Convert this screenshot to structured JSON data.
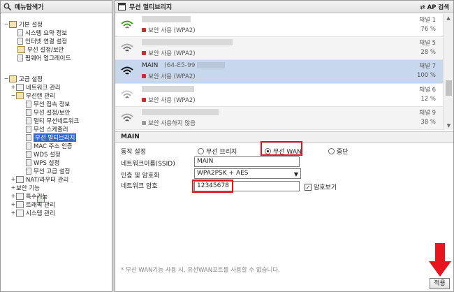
{
  "menu": {
    "title": "메뉴탐색기",
    "items": [
      {
        "label": "기본 설정"
      },
      {
        "label": "시스템 요약 정보"
      },
      {
        "label": "인터넷 연결 설정"
      },
      {
        "label": "무선 설정/보안"
      },
      {
        "label": "펌웨어 업그레이드"
      },
      {
        "label": "고급 설정"
      },
      {
        "label": "네트워크 관리"
      },
      {
        "label": "무선랜 관리"
      },
      {
        "label": "무선 접속 정보"
      },
      {
        "label": "무선 설정/보안"
      },
      {
        "label": "멀티 무선네트워크"
      },
      {
        "label": "무선 스케줄러"
      },
      {
        "label": "무선 멀티브리지"
      },
      {
        "label": "MAC 주소 인증"
      },
      {
        "label": "WDS 설정"
      },
      {
        "label": "WPS 설정"
      },
      {
        "label": "무선 고급 설정"
      },
      {
        "label": "NAT/라우터 관리"
      },
      {
        "label": "보안 기능"
      },
      {
        "label": "특수기능"
      },
      {
        "label": "트래픽 관리"
      },
      {
        "label": "시스템 관리"
      }
    ],
    "toggles": {
      "expanded": "−",
      "collapsed": "+"
    }
  },
  "main": {
    "title": "무선 멀티브리지",
    "ap_search": "AP 검색"
  },
  "ap_list": [
    {
      "ssid": "",
      "mac": "",
      "security": "보안 사용 (WPA2)",
      "channel": "채널 1",
      "signal": "76 %"
    },
    {
      "ssid": "",
      "mac": "",
      "security": "보안 사용 (WPA2)",
      "channel": "채널 5",
      "signal": "28 %"
    },
    {
      "ssid": "MAIN",
      "mac": "(64-E5-99",
      "security": "보안 사용 (WPA2)",
      "channel": "채널 7",
      "signal": "100 %"
    },
    {
      "ssid": "",
      "mac": "",
      "security": "보안 사용 (WPA2)",
      "channel": "채널 6",
      "signal": "12 %"
    },
    {
      "ssid": "",
      "mac": "",
      "security": "보안 사용하지 않음",
      "channel": "채널 9",
      "signal": "38 %"
    }
  ],
  "form": {
    "section_title": "MAIN",
    "mode_label": "동작 설정",
    "mode_options": [
      "무선 브리지",
      "무선 WAN",
      "중단"
    ],
    "ssid_label": "네트워크이름(SSID)",
    "ssid_value": "MAIN",
    "auth_label": "인증 및 암호화",
    "auth_value": "WPA2PSK + AES",
    "password_label": "네트워크 암호",
    "password_value": "12345678",
    "show_password_label": "암호보기",
    "note": "* 무선 WAN기능 사용 시, 유선WAN포트를 사용할 수 없습니다.",
    "apply_label": "적용"
  },
  "colors": {
    "highlight": "#e0141e",
    "selection": "#c8d8ec",
    "arrow": "#e8141e"
  }
}
